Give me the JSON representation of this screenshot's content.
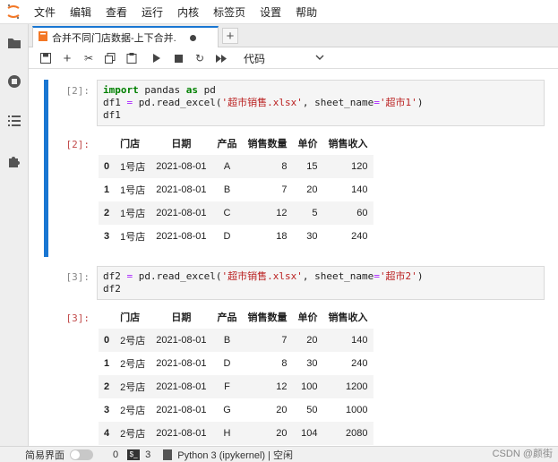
{
  "menubar": {
    "items": [
      "文件",
      "编辑",
      "查看",
      "运行",
      "内核",
      "标签页",
      "设置",
      "帮助"
    ]
  },
  "tab": {
    "title": "合并不同门店数据-上下合并.",
    "add_label": "+"
  },
  "toolbar": {
    "cell_type": "代码"
  },
  "cells": [
    {
      "in_prompt": "[2]:",
      "code_lines": [
        [
          {
            "t": "import",
            "c": "kw"
          },
          {
            "t": " pandas ",
            "c": ""
          },
          {
            "t": "as",
            "c": "kw"
          },
          {
            "t": " pd",
            "c": ""
          }
        ],
        [
          {
            "t": "df1 ",
            "c": ""
          },
          {
            "t": "=",
            "c": "eq"
          },
          {
            "t": " pd.read_excel(",
            "c": ""
          },
          {
            "t": "'超市销售.xlsx'",
            "c": "str"
          },
          {
            "t": ", sheet_name",
            "c": ""
          },
          {
            "t": "=",
            "c": "eq"
          },
          {
            "t": "'超市1'",
            "c": "str"
          },
          {
            "t": ")",
            "c": ""
          }
        ],
        [
          {
            "t": "df1",
            "c": ""
          }
        ]
      ],
      "out_prompt": "[2]:",
      "table": {
        "columns": [
          "门店",
          "日期",
          "产品",
          "销售数量",
          "单价",
          "销售收入"
        ],
        "rows": [
          {
            "index": "0",
            "values": [
              "1号店",
              "2021-08-01",
              "A",
              "8",
              "15",
              "120"
            ]
          },
          {
            "index": "1",
            "values": [
              "1号店",
              "2021-08-01",
              "B",
              "7",
              "20",
              "140"
            ]
          },
          {
            "index": "2",
            "values": [
              "1号店",
              "2021-08-01",
              "C",
              "12",
              "5",
              "60"
            ]
          },
          {
            "index": "3",
            "values": [
              "1号店",
              "2021-08-01",
              "D",
              "18",
              "30",
              "240"
            ]
          }
        ]
      }
    },
    {
      "in_prompt": "[3]:",
      "code_lines": [
        [
          {
            "t": "df2 ",
            "c": ""
          },
          {
            "t": "=",
            "c": "eq"
          },
          {
            "t": " pd.read_excel(",
            "c": ""
          },
          {
            "t": "'超市销售.xlsx'",
            "c": "str"
          },
          {
            "t": ", sheet_name",
            "c": ""
          },
          {
            "t": "=",
            "c": "eq"
          },
          {
            "t": "'超市2'",
            "c": "str"
          },
          {
            "t": ")",
            "c": ""
          }
        ],
        [
          {
            "t": "df2",
            "c": ""
          }
        ]
      ],
      "out_prompt": "[3]:",
      "table": {
        "columns": [
          "门店",
          "日期",
          "产品",
          "销售数量",
          "单价",
          "销售收入"
        ],
        "rows": [
          {
            "index": "0",
            "values": [
              "2号店",
              "2021-08-01",
              "B",
              "7",
              "20",
              "140"
            ]
          },
          {
            "index": "1",
            "values": [
              "2号店",
              "2021-08-01",
              "D",
              "8",
              "30",
              "240"
            ]
          },
          {
            "index": "2",
            "values": [
              "2号店",
              "2021-08-01",
              "F",
              "12",
              "100",
              "1200"
            ]
          },
          {
            "index": "3",
            "values": [
              "2号店",
              "2021-08-01",
              "G",
              "20",
              "50",
              "1000"
            ]
          },
          {
            "index": "4",
            "values": [
              "2号店",
              "2021-08-01",
              "H",
              "20",
              "104",
              "2080"
            ]
          }
        ]
      }
    }
  ],
  "statusbar": {
    "simple_mode_label": "简易界面",
    "count_a": "0",
    "count_b": "3",
    "kernel_status": "Python 3 (ipykernel) | 空闲"
  },
  "watermark": "CSDN @颜街",
  "colors": {
    "accent": "#1976d2",
    "logo": "#f37726"
  }
}
